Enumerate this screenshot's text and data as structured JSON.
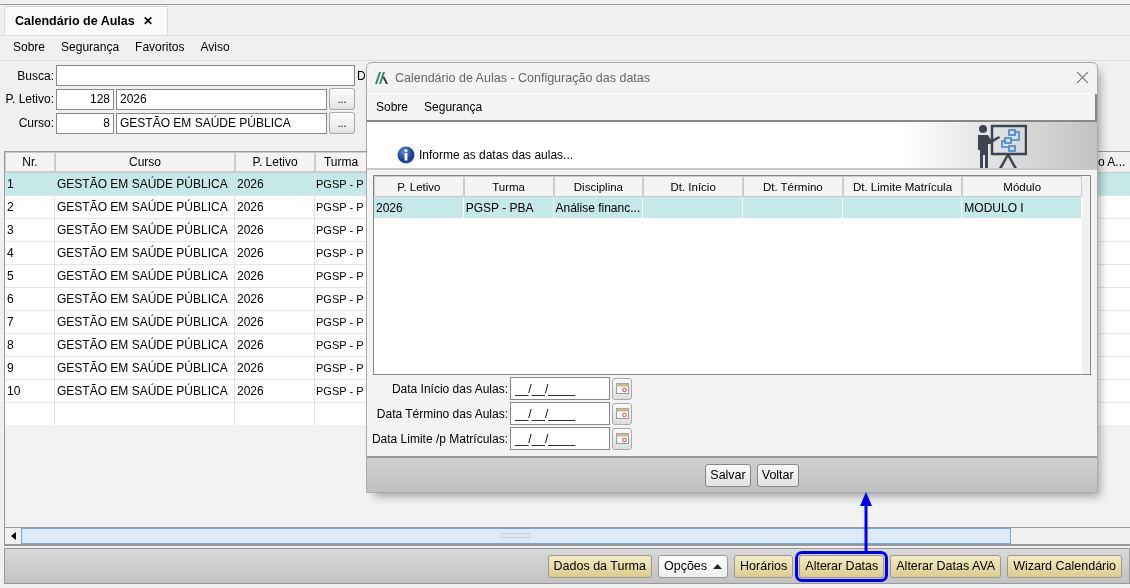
{
  "tab": {
    "label": "Calendário de Aulas",
    "close": "✕",
    "selected": true
  },
  "menu": [
    "Sobre",
    "Segurança",
    "Favoritos",
    "Aviso"
  ],
  "form": {
    "fields": [
      {
        "label": "Busca:",
        "kind": "search"
      },
      {
        "label": "P. Letivo:",
        "kind": "lookup",
        "code": "128",
        "value": "2026",
        "button": "..."
      },
      {
        "label": "Curso:",
        "kind": "lookup",
        "code": "8",
        "value": "GESTÃO EM SAÚDE PÚBLICA",
        "button": "..."
      }
    ],
    "cut_label": "D"
  },
  "table": {
    "columns": [
      "Nr.",
      "Curso",
      "P. Letivo",
      "Turma"
    ],
    "cut_column": "o A...",
    "rows": [
      {
        "cells": [
          "1",
          "GESTÃO EM SAÚDE PÚBLICA",
          "2026",
          "PGSP - P"
        ],
        "selected": true
      },
      {
        "cells": [
          "2",
          "GESTÃO EM SAÚDE PÚBLICA",
          "2026",
          "PGSP - P"
        ],
        "selected": false
      },
      {
        "cells": [
          "3",
          "GESTÃO EM SAÚDE PÚBLICA",
          "2026",
          "PGSP - P"
        ],
        "selected": false
      },
      {
        "cells": [
          "4",
          "GESTÃO EM SAÚDE PÚBLICA",
          "2026",
          "PGSP - P"
        ],
        "selected": false
      },
      {
        "cells": [
          "5",
          "GESTÃO EM SAÚDE PÚBLICA",
          "2026",
          "PGSP - P"
        ],
        "selected": false
      },
      {
        "cells": [
          "6",
          "GESTÃO EM SAÚDE PÚBLICA",
          "2026",
          "PGSP - P"
        ],
        "selected": false
      },
      {
        "cells": [
          "7",
          "GESTÃO EM SAÚDE PÚBLICA",
          "2026",
          "PGSP - P"
        ],
        "selected": false
      },
      {
        "cells": [
          "8",
          "GESTÃO EM SAÚDE PÚBLICA",
          "2026",
          "PGSP - P"
        ],
        "selected": false
      },
      {
        "cells": [
          "9",
          "GESTÃO EM SAÚDE PÚBLICA",
          "2026",
          "PGSP - P"
        ],
        "selected": false
      },
      {
        "cells": [
          "10",
          "GESTÃO EM SAÚDE PÚBLICA",
          "2026",
          "PGSP - P"
        ],
        "selected": false
      }
    ]
  },
  "buttons": [
    {
      "label": "Dados da Turma",
      "kind": "action",
      "highlighted": false
    },
    {
      "label": "Opções",
      "kind": "dropdown",
      "highlighted": false
    },
    {
      "label": "Horários",
      "kind": "action",
      "highlighted": false
    },
    {
      "label": "Alterar Datas",
      "kind": "action",
      "highlighted": true
    },
    {
      "label": "Alterar Datas AVA",
      "kind": "action",
      "highlighted": false
    },
    {
      "label": "Wizard Calendário",
      "kind": "action",
      "highlighted": false
    }
  ],
  "dialog": {
    "title": "Calendário de Aulas - Configuração das datas",
    "menu": [
      "Sobre",
      "Segurança"
    ],
    "message": "Informe as datas das aulas...",
    "table": {
      "columns": [
        "P. Letivo",
        "Turma",
        "Disciplina",
        "Dt. Início",
        "Dt. Término",
        "Dt. Limite Matrícula",
        "Módulo"
      ],
      "rows": [
        {
          "cells": [
            "2026",
            "PGSP - PBA",
            "Análise financ...",
            null,
            null,
            null,
            "MODULO I"
          ],
          "selected": true
        }
      ]
    },
    "date_fields": [
      {
        "label": "Data Início das Aulas:",
        "value": "__/__/____"
      },
      {
        "label": "Data Término das Aulas:",
        "value": "__/__/____"
      },
      {
        "label": "Data Limite /p Matrículas:",
        "value": "__/__/____"
      }
    ],
    "buttons": [
      "Salvar",
      "Voltar"
    ]
  }
}
